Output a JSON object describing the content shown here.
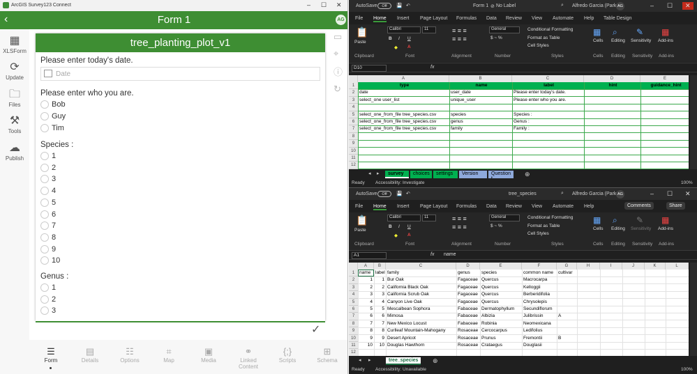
{
  "survey123": {
    "app_title": "ArcGIS Survey123 Connect",
    "window_title": "Form 1",
    "avatar": "AG",
    "nav": [
      {
        "icon": "xlsform-icon",
        "label": "XLSForm"
      },
      {
        "icon": "update-icon",
        "label": "Update"
      },
      {
        "icon": "files-icon",
        "label": "Files"
      },
      {
        "icon": "tools-icon",
        "label": "Tools"
      },
      {
        "icon": "publish-icon",
        "label": "Publish"
      }
    ],
    "form_title": "tree_planting_plot_v1",
    "q_date": "Please enter today's date.",
    "date_placeholder": "Date",
    "q_who": "Please enter who you are.",
    "who_options": [
      "Bob",
      "Guy",
      "Tim"
    ],
    "q_species": "Species :",
    "species_options": [
      "1",
      "2",
      "3",
      "4",
      "5",
      "6",
      "7",
      "8",
      "9",
      "10"
    ],
    "q_genus": "Genus :",
    "genus_options": [
      "1",
      "2",
      "3"
    ],
    "tabs": [
      "Form",
      "Details",
      "Options",
      "Map",
      "Media",
      "Linked Content",
      "Scripts",
      "Schema"
    ]
  },
  "excel_top": {
    "autosave": "AutoSave",
    "toggle": "Off",
    "title": "Form 1",
    "label": "No Label",
    "user": "Alfredo Garcia (Parks)",
    "avatar": "AG",
    "ribbon_tabs": [
      "File",
      "Home",
      "Insert",
      "Page Layout",
      "Formulas",
      "Data",
      "Review",
      "View",
      "Automate",
      "Help",
      "Table Design"
    ],
    "font": "Calibri",
    "size": "11",
    "numfmt": "General",
    "cond_fmt": "Conditional Formatting",
    "fmt_table": "Format as Table",
    "cell_styles": "Cell Styles",
    "groups": [
      "Clipboard",
      "Font",
      "Alignment",
      "Number",
      "Styles",
      "Cells",
      "Editing",
      "Sensitivity",
      "Add-ins"
    ],
    "paste": "Paste",
    "cells": "Cells",
    "editing": "Editing",
    "sensitivity": "Sensitivity",
    "addins": "Add-ins",
    "namebox": "D10",
    "fx": "fx",
    "columns": [
      "A",
      "B",
      "C",
      "D",
      "E"
    ],
    "headers": [
      "type",
      "name",
      "label",
      "hint",
      "guidance_hint"
    ],
    "rows": [
      [
        "date",
        "user_date",
        "Please enter today's date."
      ],
      [
        "select_one user_list",
        "unique_user",
        "Please enter who you are."
      ],
      [
        "",
        "",
        ""
      ],
      [
        "select_one_from_file tree_species.csv",
        "species",
        "Species :"
      ],
      [
        "select_one_from_file tree_species.csv",
        "genus",
        "Genus :"
      ],
      [
        "select_one_from_file tree_species.csv",
        "family",
        "Family :"
      ]
    ],
    "row_numbers": [
      "1",
      "2",
      "3",
      "4",
      "5",
      "6",
      "7",
      "8",
      "9",
      "10",
      "11",
      "12"
    ],
    "sheets": [
      "survey",
      "choices",
      "settings",
      "Version",
      "Question t"
    ],
    "status": "Ready",
    "accessibility": "Accessibility: Investigate",
    "zoom": "100%"
  },
  "excel_bottom": {
    "autosave": "AutoSave",
    "toggle": "Off",
    "title": "tree_species",
    "user": "Alfredo Garcia (Parks)",
    "avatar": "AG",
    "comments": "Comments",
    "share": "Share",
    "ribbon_tabs": [
      "File",
      "Home",
      "Insert",
      "Page Layout",
      "Formulas",
      "Data",
      "Review",
      "View",
      "Automate",
      "Help"
    ],
    "font": "Calibri",
    "size": "11",
    "numfmt": "General",
    "cond_fmt": "Conditional Formatting",
    "fmt_table": "Format as Table",
    "cell_styles": "Cell Styles",
    "groups": [
      "Clipboard",
      "Font",
      "Alignment",
      "Number",
      "Styles",
      "Cells",
      "Editing",
      "Sensitivity",
      "Add-ins"
    ],
    "paste": "Paste",
    "cells": "Cells",
    "editing": "Editing",
    "sensitivity": "Sensitivity",
    "addins": "Add-ins",
    "namebox": "A1",
    "fx": "fx",
    "formula": "name",
    "columns": [
      "A",
      "B",
      "C",
      "D",
      "E",
      "F",
      "G",
      "H",
      "I",
      "J",
      "K",
      "L"
    ],
    "headers": [
      "name",
      "label",
      "family",
      "genus",
      "species",
      "common name",
      "cultivar"
    ],
    "rows": [
      [
        "1",
        "1",
        "Bur Oak",
        "Fagaceae",
        "Quercus",
        "Macrocarpa",
        ""
      ],
      [
        "2",
        "2",
        "California Black Oak",
        "Fagaceae",
        "Quercus",
        "Kelloggii",
        ""
      ],
      [
        "3",
        "3",
        "California Scrub Oak",
        "Fagaceae",
        "Quercus",
        "Berberidifolia",
        ""
      ],
      [
        "4",
        "4",
        "Canyon Live Oak",
        "Fagaceae",
        "Quercus",
        "Chrysolepis",
        ""
      ],
      [
        "5",
        "5",
        "Mescalbean Sophora",
        "Fabaceae",
        "Dermatophyllum",
        "Secundiflorum",
        ""
      ],
      [
        "6",
        "6",
        "Mimosa",
        "Fabaceae",
        "Albizia",
        "Julibrissin",
        "A"
      ],
      [
        "7",
        "7",
        "New Mexico Locust",
        "Fabaceae",
        "Robinia",
        "Neomexicana",
        ""
      ],
      [
        "8",
        "8",
        "Curlleaf Mountain-Mahogany",
        "Rosaceae",
        "Cercocarpus",
        "Ledifolius",
        ""
      ],
      [
        "9",
        "9",
        "Desert Apricot",
        "Rosaceae",
        "Prunus",
        "Fremontii",
        "B"
      ],
      [
        "10",
        "10",
        "Douglas Hawthorn",
        "Rosaceae",
        "Crataegus",
        "Douglasii",
        ""
      ]
    ],
    "row_numbers": [
      "1",
      "2",
      "3",
      "4",
      "5",
      "6",
      "7",
      "8",
      "9",
      "10",
      "11",
      "12"
    ],
    "sheets": [
      "tree_species"
    ],
    "status": "Ready",
    "accessibility": "Accessibility: Unavailable",
    "zoom": "100%"
  }
}
